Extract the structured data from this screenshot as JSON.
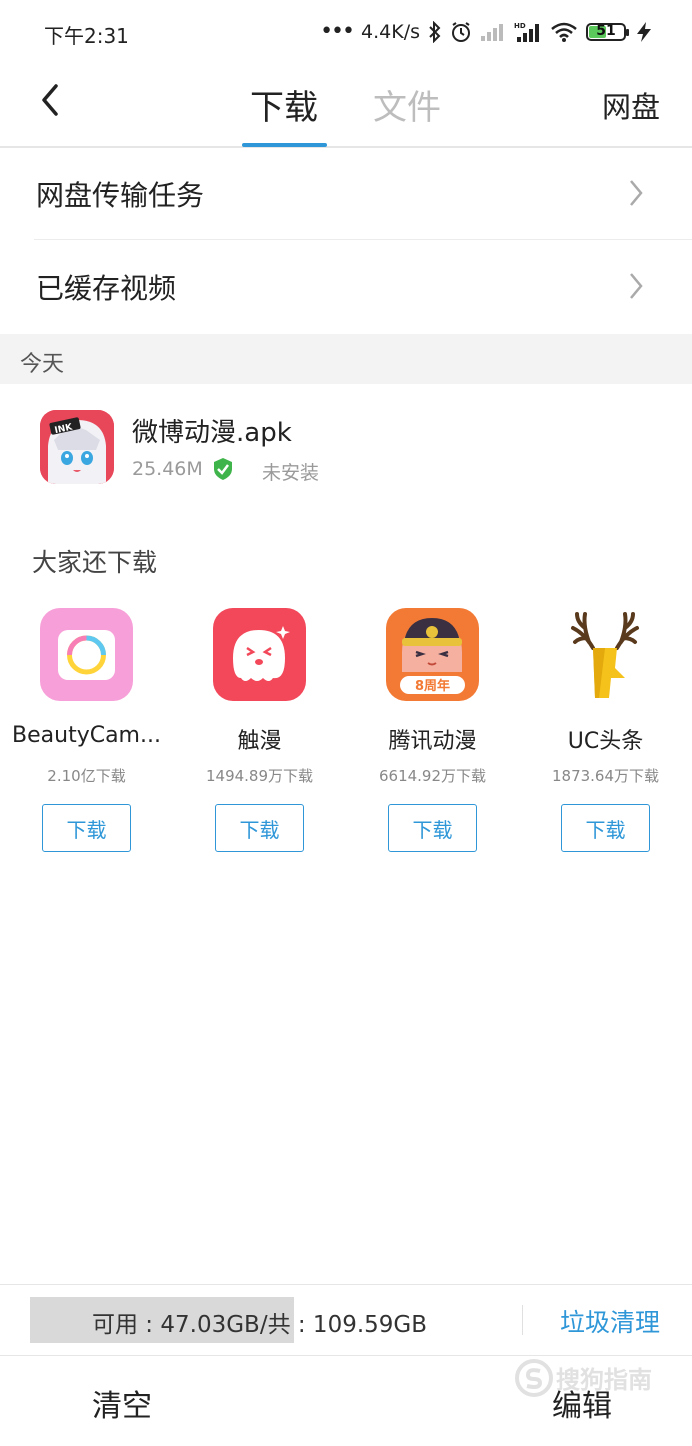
{
  "status_bar": {
    "time": "下午2:31",
    "net_speed": "4.4K/s",
    "battery": "51",
    "battery_level": 0.51
  },
  "nav": {
    "tabs": [
      {
        "label": "下载",
        "active": true
      },
      {
        "label": "文件",
        "active": false
      }
    ],
    "right_label": "网盘",
    "accent_color": "#2f97d8"
  },
  "menu": {
    "items": [
      {
        "label": "网盘传输任务"
      },
      {
        "label": "已缓存视频"
      }
    ]
  },
  "today": {
    "header": "今天",
    "item": {
      "name": "微博动漫.apk",
      "size": "25.46M",
      "status": "未安装",
      "icon": "anime-girl-app-icon"
    }
  },
  "recommend": {
    "title": "大家还下载",
    "apps": [
      {
        "name": "BeautyCam...",
        "count": "2.10亿下载",
        "button": "下载",
        "icon": "camera-app-icon"
      },
      {
        "name": "触漫",
        "count": "1494.89万下载",
        "button": "下载",
        "icon": "ghost-app-icon"
      },
      {
        "name": "腾讯动漫",
        "count": "6614.92万下载",
        "button": "下载",
        "icon": "anime-character-app-icon",
        "badge": "8周年"
      },
      {
        "name": "UC头条",
        "count": "1873.64万下载",
        "button": "下载",
        "icon": "deer-app-icon"
      }
    ]
  },
  "storage": {
    "text": "可用 : 47.03GB/共 : 109.59GB",
    "clean_label": "垃圾清理"
  },
  "bottom": {
    "clear_label": "清空",
    "edit_label": "编辑"
  },
  "watermark": {
    "text": "搜狗指南"
  }
}
